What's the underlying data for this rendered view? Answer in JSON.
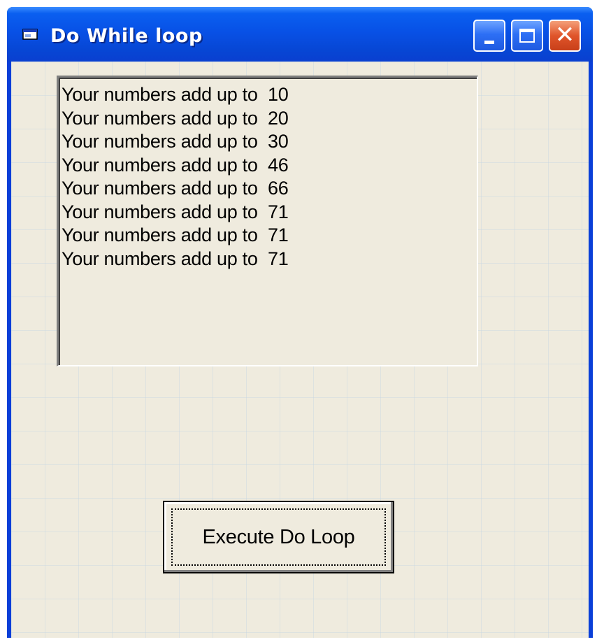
{
  "window": {
    "title": "Do While loop"
  },
  "list": {
    "items": [
      "Your numbers add up to  10",
      "Your numbers add up to  20",
      "Your numbers add up to  30",
      "Your numbers add up to  46",
      "Your numbers add up to  66",
      "Your numbers add up to  71",
      "Your numbers add up to  71",
      "Your numbers add up to  71"
    ]
  },
  "button": {
    "label": "Execute Do Loop"
  },
  "icons": {
    "app": "form-window-icon",
    "minimize": "minimize-icon",
    "maximize": "maximize-icon",
    "close": "close-icon"
  },
  "colors": {
    "titlebar": "#0851e6",
    "client_bg": "#efebde",
    "close_button": "#e0552a"
  }
}
